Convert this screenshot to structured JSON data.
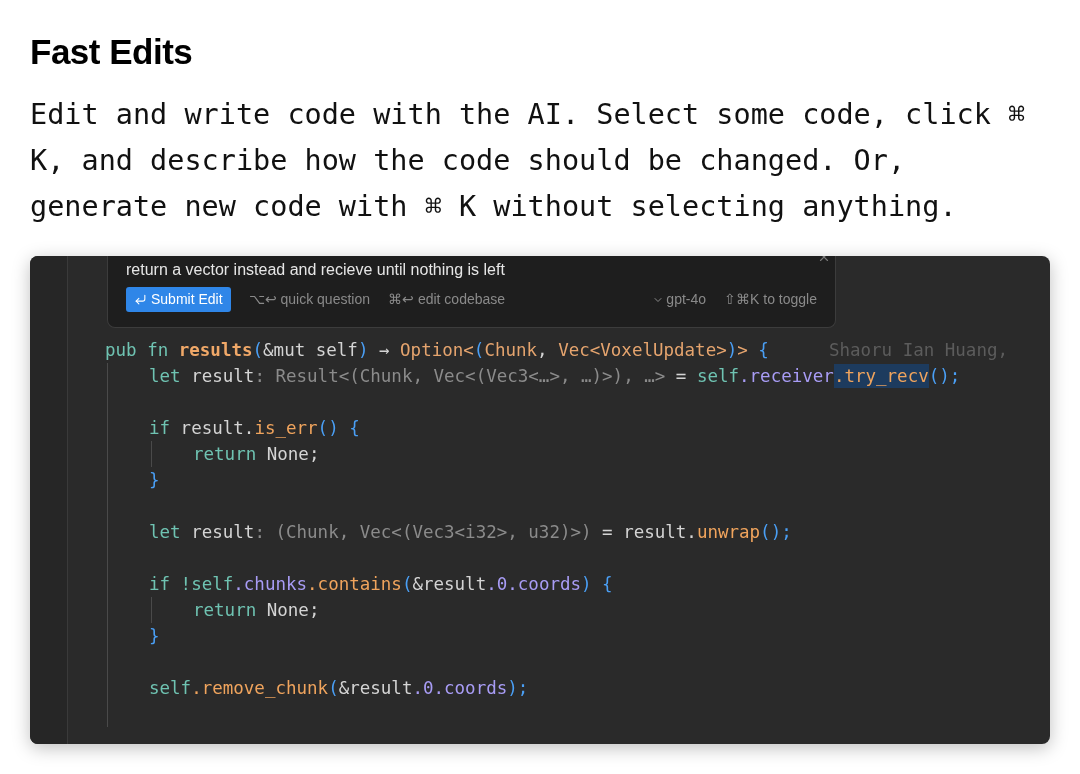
{
  "heading": "Fast Edits",
  "description": "Edit and write code with the AI. Select some code, click ⌘ K, and describe how the code should be changed. Or, generate new code with ⌘ K without selecting anything.",
  "prompt_panel": {
    "prompt": "return a vector instead and recieve until nothing is left",
    "submit_button": "Submit Edit",
    "hints": [
      "⌥↩ quick question",
      "⌘↩ edit codebase"
    ],
    "model": "gpt-4o",
    "toggle_hint": "⇧⌘K to toggle"
  },
  "code": [
    {
      "kind": "code",
      "blame": "Shaoru Ian Huang,",
      "tokens": [
        {
          "kind": "plain",
          "text": "pub fn ",
          "color": "#6fc3b2"
        },
        {
          "kind": "bold",
          "text": "results",
          "color": "#f0a868"
        },
        {
          "kind": "plain",
          "text": "(",
          "color": "#4a9ff5"
        },
        {
          "kind": "plain",
          "text": "&mut self",
          "color": "#d4d4d4"
        },
        {
          "kind": "plain",
          "text": ")",
          "color": "#4a9ff5"
        },
        {
          "kind": "plain",
          "text": " → ",
          "color": "#d4d4d4"
        },
        {
          "kind": "plain",
          "text": "Option<",
          "color": "#e5a46e"
        },
        {
          "kind": "plain",
          "text": "(",
          "color": "#4a9ff5"
        },
        {
          "kind": "plain",
          "text": "Chunk",
          "color": "#e5a46e"
        },
        {
          "kind": "plain",
          "text": ", ",
          "color": "#d4d4d4"
        },
        {
          "kind": "plain",
          "text": "Vec<VoxelUpdate>",
          "color": "#e5a46e"
        },
        {
          "kind": "plain",
          "text": ")",
          "color": "#4a9ff5"
        },
        {
          "kind": "plain",
          "text": "> ",
          "color": "#e5a46e"
        },
        {
          "kind": "plain",
          "text": "{",
          "color": "#4a9ff5"
        }
      ],
      "children": [
        {
          "kind": "code",
          "tokens": [
            {
              "kind": "plain",
              "text": "let ",
              "color": "#6fc3b2"
            },
            {
              "kind": "plain",
              "text": "result",
              "color": "#d4d4d4"
            },
            {
              "kind": "plain",
              "text": ": Result<(Chunk, Vec<(Vec3<…>, …)>), …> ",
              "color": "#8b8b8b"
            },
            {
              "kind": "plain",
              "text": "= ",
              "color": "#d4d4d4"
            },
            {
              "kind": "plain",
              "text": "self",
              "color": "#6fc3b2"
            },
            {
              "kind": "plain",
              "text": ".receiver",
              "color": "#a89cf5"
            },
            {
              "kind": "selection",
              "text": ".try_recv",
              "color": "#f0a45d"
            },
            {
              "kind": "plain",
              "text": "();",
              "color": "#4a9ff5"
            }
          ]
        },
        {
          "kind": "blank"
        },
        {
          "kind": "code",
          "tokens": [
            {
              "kind": "plain",
              "text": "if ",
              "color": "#6fc3b2"
            },
            {
              "kind": "plain",
              "text": "result.",
              "color": "#d4d4d4"
            },
            {
              "kind": "plain",
              "text": "is_err",
              "color": "#f0a45d"
            },
            {
              "kind": "plain",
              "text": "() {",
              "color": "#4a9ff5"
            }
          ],
          "children": [
            {
              "kind": "code",
              "tokens": [
                {
                  "kind": "plain",
                  "text": "return ",
                  "color": "#6fc3b2"
                },
                {
                  "kind": "plain",
                  "text": "None;",
                  "color": "#d4d4d4"
                }
              ]
            }
          ]
        },
        {
          "kind": "code",
          "tokens": [
            {
              "kind": "plain",
              "text": "}",
              "color": "#4a9ff5"
            }
          ]
        },
        {
          "kind": "blank"
        },
        {
          "kind": "code",
          "tokens": [
            {
              "kind": "plain",
              "text": "let ",
              "color": "#6fc3b2"
            },
            {
              "kind": "plain",
              "text": "result",
              "color": "#d4d4d4"
            },
            {
              "kind": "plain",
              "text": ": (Chunk, Vec<(Vec3<i32>, u32)>) ",
              "color": "#8b8b8b"
            },
            {
              "kind": "plain",
              "text": "= result.",
              "color": "#d4d4d4"
            },
            {
              "kind": "plain",
              "text": "unwrap",
              "color": "#f0a45d"
            },
            {
              "kind": "plain",
              "text": "();",
              "color": "#4a9ff5"
            }
          ]
        },
        {
          "kind": "blank"
        },
        {
          "kind": "code",
          "tokens": [
            {
              "kind": "plain",
              "text": "if ",
              "color": "#6fc3b2"
            },
            {
              "kind": "plain",
              "text": "!self",
              "color": "#6fc3b2"
            },
            {
              "kind": "plain",
              "text": ".chunks",
              "color": "#a89cf5"
            },
            {
              "kind": "plain",
              "text": ".contains",
              "color": "#f0a45d"
            },
            {
              "kind": "plain",
              "text": "(",
              "color": "#4a9ff5"
            },
            {
              "kind": "plain",
              "text": "&result",
              "color": "#d4d4d4"
            },
            {
              "kind": "plain",
              "text": ".0.coords",
              "color": "#a89cf5"
            },
            {
              "kind": "plain",
              "text": ") {",
              "color": "#4a9ff5"
            }
          ],
          "children": [
            {
              "kind": "code",
              "tokens": [
                {
                  "kind": "plain",
                  "text": "return ",
                  "color": "#6fc3b2"
                },
                {
                  "kind": "plain",
                  "text": "None;",
                  "color": "#d4d4d4"
                }
              ]
            }
          ]
        },
        {
          "kind": "code",
          "tokens": [
            {
              "kind": "plain",
              "text": "}",
              "color": "#4a9ff5"
            }
          ]
        },
        {
          "kind": "blank"
        },
        {
          "kind": "code",
          "tokens": [
            {
              "kind": "plain",
              "text": "self",
              "color": "#6fc3b2"
            },
            {
              "kind": "plain",
              "text": ".remove_chunk",
              "color": "#f0a45d"
            },
            {
              "kind": "plain",
              "text": "(",
              "color": "#4a9ff5"
            },
            {
              "kind": "plain",
              "text": "&result",
              "color": "#d4d4d4"
            },
            {
              "kind": "plain",
              "text": ".0.coords",
              "color": "#a89cf5"
            },
            {
              "kind": "plain",
              "text": ");",
              "color": "#4a9ff5"
            }
          ]
        },
        {
          "kind": "blank"
        }
      ]
    }
  ]
}
